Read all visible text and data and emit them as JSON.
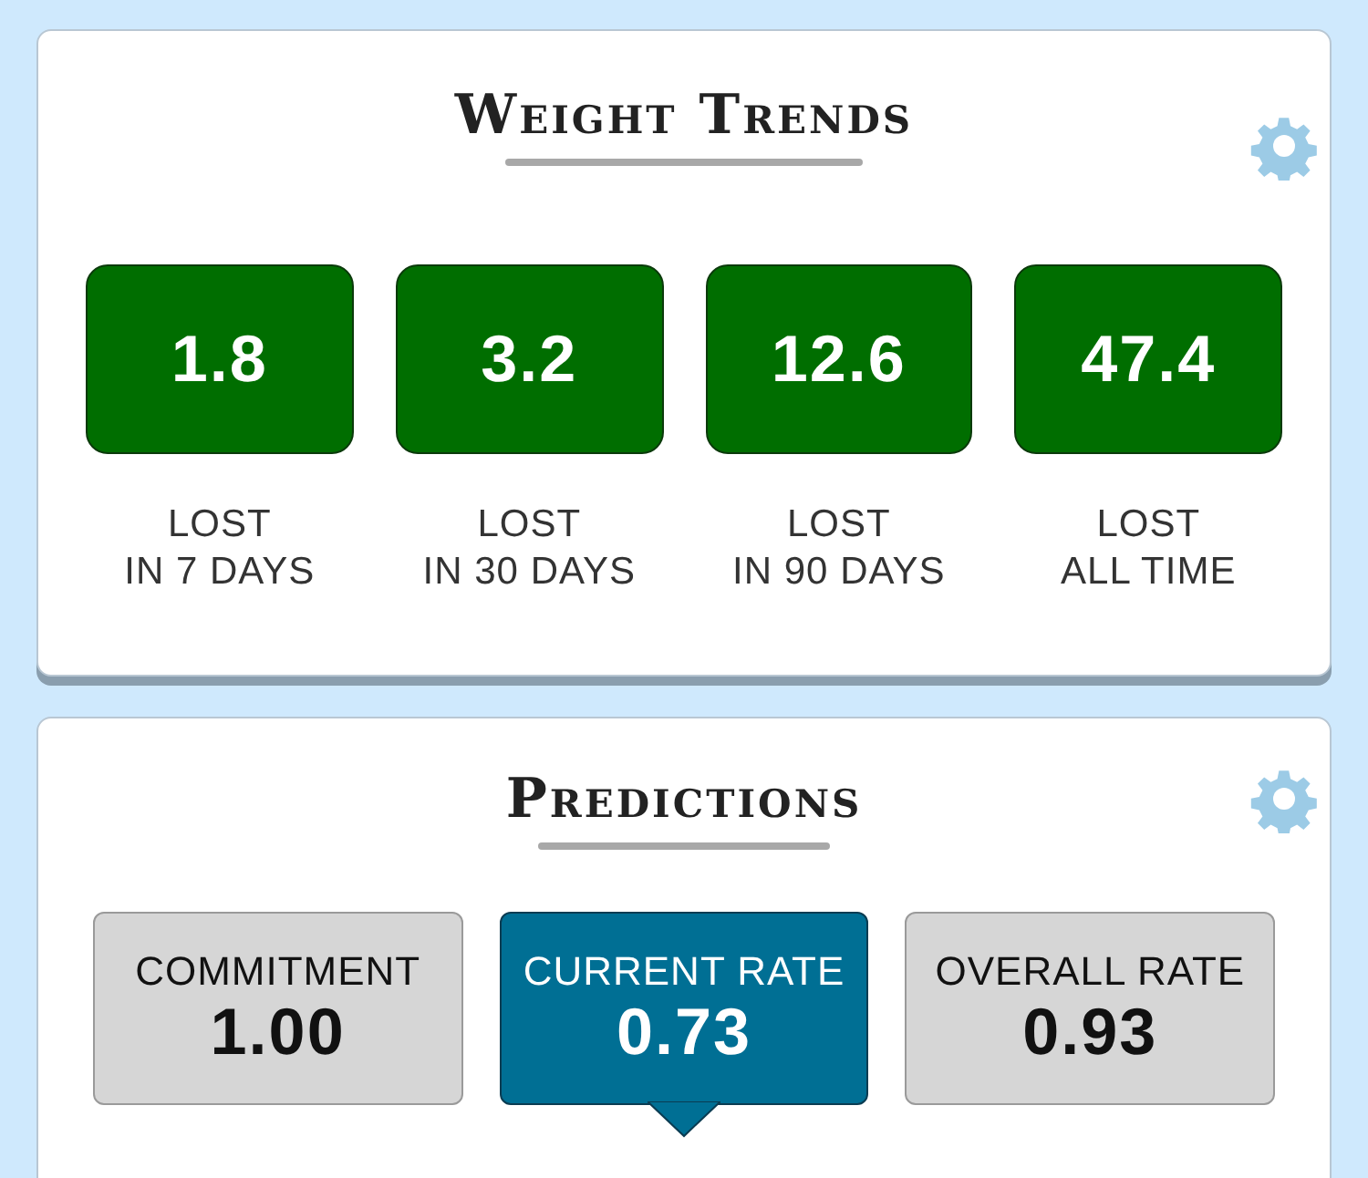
{
  "trends": {
    "title": "Weight Trends",
    "stats": [
      {
        "value": "1.8",
        "label": "LOST\nIN 7 DAYS"
      },
      {
        "value": "3.2",
        "label": "LOST\nIN 30 DAYS"
      },
      {
        "value": "12.6",
        "label": "LOST\nIN 90 DAYS"
      },
      {
        "value": "47.4",
        "label": "LOST\nALL TIME"
      }
    ]
  },
  "predictions": {
    "title": "Predictions",
    "options": [
      {
        "label": "COMMITMENT",
        "value": "1.00",
        "selected": false
      },
      {
        "label": "CURRENT RATE",
        "value": "0.73",
        "selected": true
      },
      {
        "label": "OVERALL RATE",
        "value": "0.93",
        "selected": false
      }
    ]
  }
}
